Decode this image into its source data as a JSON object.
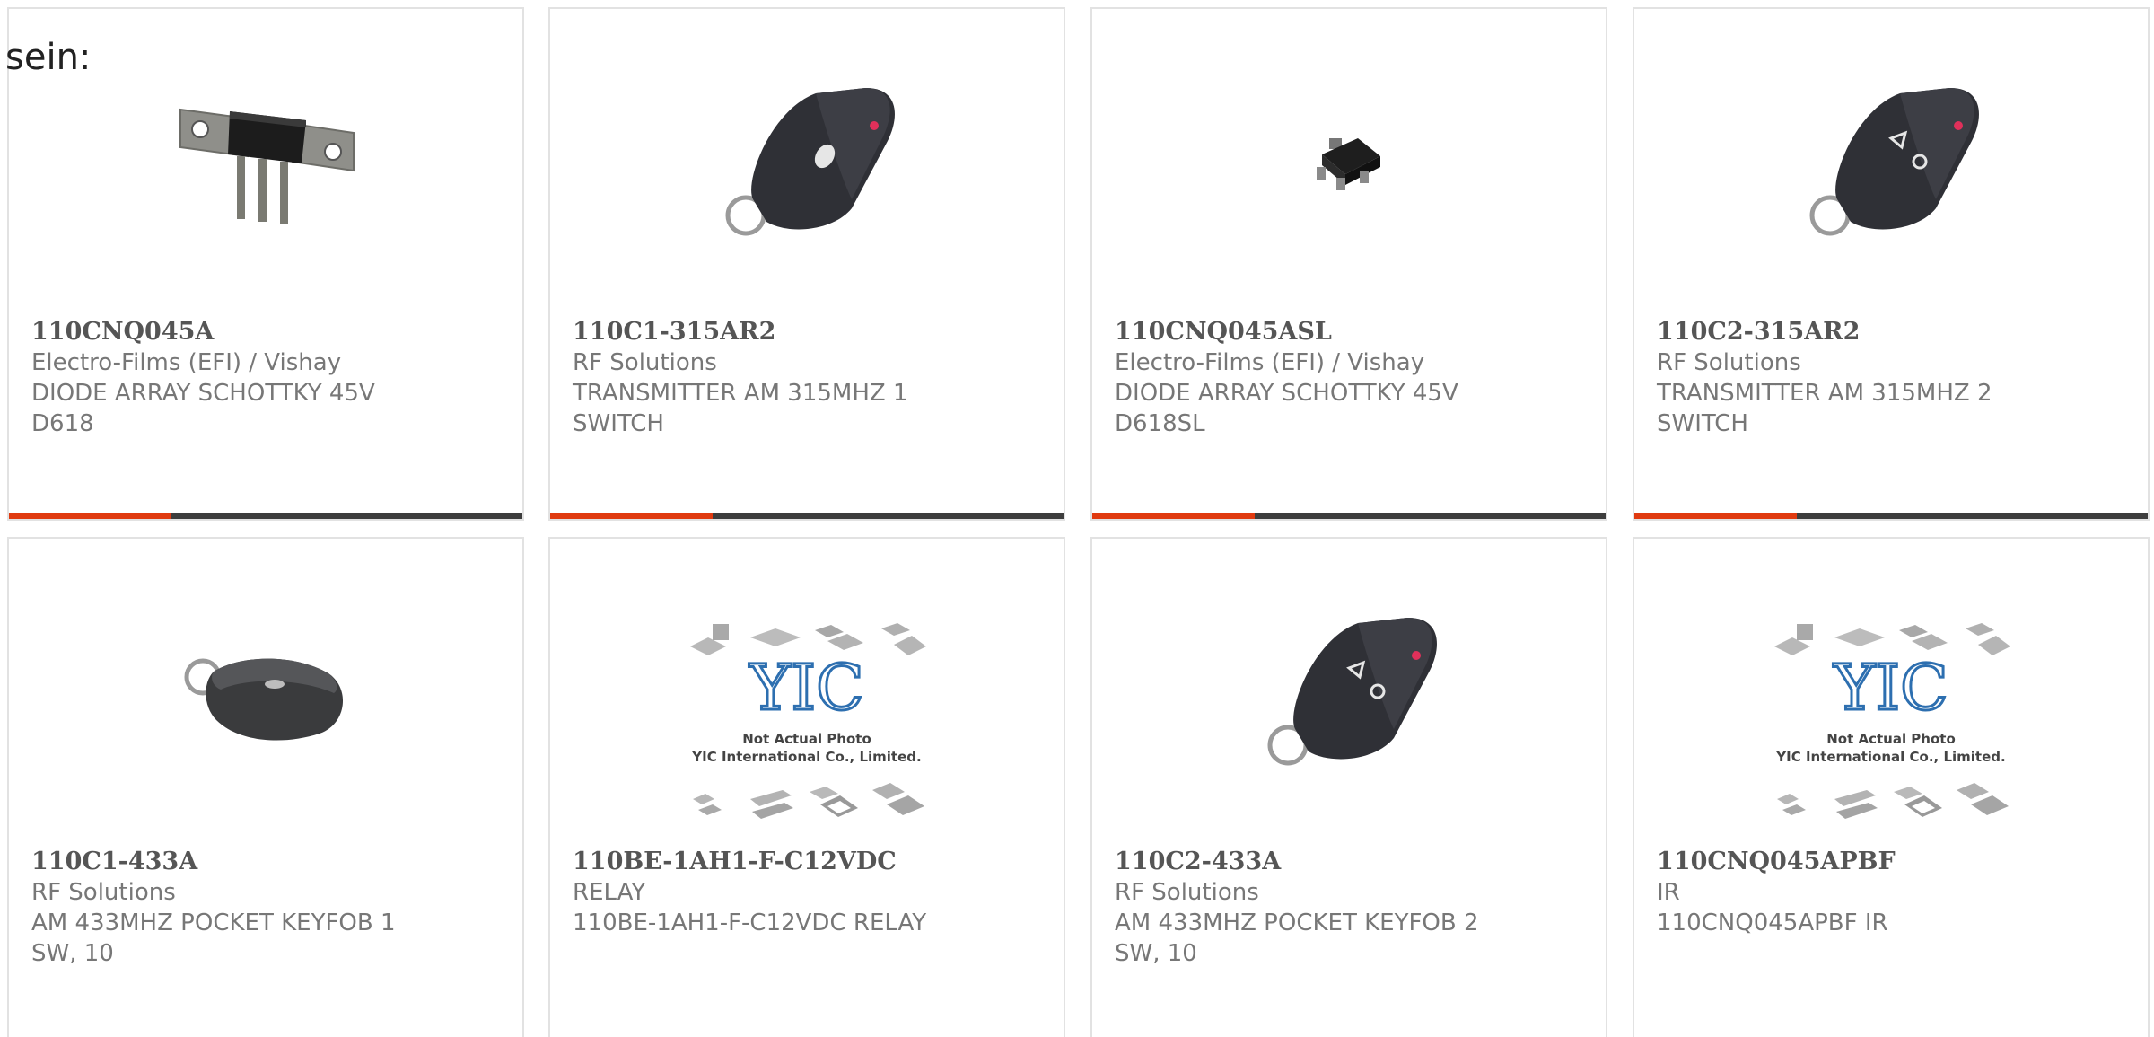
{
  "intro_text": "sein:",
  "colors": {
    "card_border": "#e2e2e2",
    "bar_dark": "#3d3d3d",
    "bar_accent": "#e03a10",
    "text_gray": "#777777",
    "title_gray": "#555555"
  },
  "products": [
    {
      "part": "110CNQ045A",
      "manufacturer": "Electro-Films (EFI) / Vishay",
      "desc1": "DIODE ARRAY SCHOTTKY 45V",
      "desc2": "D618",
      "image": "diode-array-icon"
    },
    {
      "part": "110C1-315AR2",
      "manufacturer": "RF Solutions",
      "desc1": "TRANSMITTER AM 315MHZ 1",
      "desc2": "SWITCH",
      "image": "keyfob-1-button-icon"
    },
    {
      "part": "110CNQ045ASL",
      "manufacturer": "Electro-Films (EFI) / Vishay",
      "desc1": "DIODE ARRAY SCHOTTKY 45V",
      "desc2": "D618SL",
      "image": "smd-diode-icon"
    },
    {
      "part": "110C2-315AR2",
      "manufacturer": "RF Solutions",
      "desc1": "TRANSMITTER AM 315MHZ 2",
      "desc2": "SWITCH",
      "image": "keyfob-2-button-icon"
    },
    {
      "part": "110C1-433A",
      "manufacturer": "RF Solutions",
      "desc1": "AM 433MHZ POCKET KEYFOB 1",
      "desc2": "SW, 10",
      "image": "pocket-keyfob-icon"
    },
    {
      "part": "110BE-1AH1-F-C12VDC",
      "manufacturer": "RELAY",
      "desc1": "110BE-1AH1-F-C12VDC RELAY",
      "desc2": "",
      "image": "placeholder-photo-icon"
    },
    {
      "part": "110C2-433A",
      "manufacturer": "RF Solutions",
      "desc1": "AM 433MHZ POCKET KEYFOB 2",
      "desc2": "SW, 10",
      "image": "keyfob-2-button-icon"
    },
    {
      "part": "110CNQ045APBF",
      "manufacturer": "IR",
      "desc1": "110CNQ045APBF IR",
      "desc2": "",
      "image": "placeholder-photo-icon"
    }
  ],
  "placeholder": {
    "logo": "YIC",
    "line1": "Not Actual Photo",
    "line2": "YIC International Co., Limited."
  }
}
